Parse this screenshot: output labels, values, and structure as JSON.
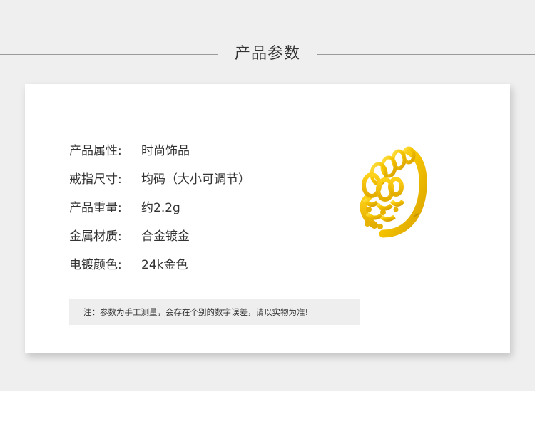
{
  "section": {
    "title": "产品参数"
  },
  "specs": [
    {
      "label": "产品属性:",
      "value": "时尚饰品"
    },
    {
      "label": "戒指尺寸:",
      "value": "均码（大小可调节）"
    },
    {
      "label": "产品重量:",
      "value": "约2.2g"
    },
    {
      "label": "金属材质:",
      "value": "合金镀金"
    },
    {
      "label": "电镀颜色:",
      "value": "24k金色"
    }
  ],
  "note": "注：参数为手工测量，会存在个别的数字误差，请以实物为准!",
  "colors": {
    "background": "#efefef",
    "card": "#ffffff",
    "text": "#333333",
    "gold": "#f4c400"
  },
  "image": {
    "subject": "gold crown ring"
  }
}
